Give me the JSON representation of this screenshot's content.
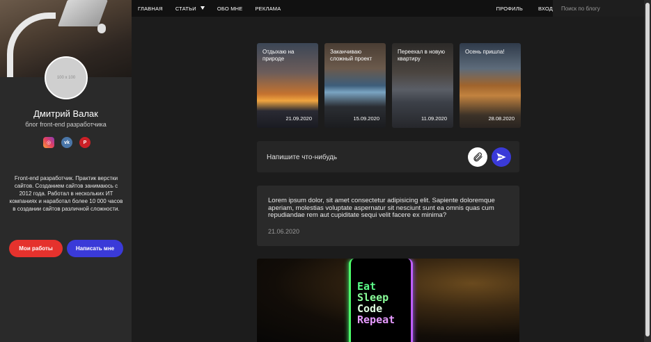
{
  "profile": {
    "avatar_placeholder": "100 x 100",
    "name": "Дмитрий Валак",
    "subtitle": "блог front-end разработчика",
    "socials": [
      {
        "name": "instagram-icon",
        "glyph": "◎"
      },
      {
        "name": "vk-icon",
        "glyph": "vk"
      },
      {
        "name": "pinterest-icon",
        "glyph": "P"
      }
    ],
    "bio": "Front-end разработчик. Практик верстки сайтов. Созданием сайтов занимаюсь с 2012 года. Работал в нескольких ИТ компаниях и наработал более 10 000 часов в создании сайтов различной сложности.",
    "btn_works": "Мои работы",
    "btn_write": "Написать мне"
  },
  "nav": {
    "home": "ГЛАВНАЯ",
    "articles": "СТАТЬИ",
    "about": "ОБО МНЕ",
    "ads": "РЕКЛАМА",
    "profile": "ПРОФИЛЬ",
    "login": "ВХОД",
    "search_placeholder": "Поиск по блогу"
  },
  "cards": [
    {
      "title": "Отдыхаю на природе",
      "date": "21.09.2020"
    },
    {
      "title": "Заканчиваю сложный проект",
      "date": "15.09.2020"
    },
    {
      "title": "Переехал в новую квартиру",
      "date": "11.09.2020"
    },
    {
      "title": "Осень пришла!",
      "date": "28.08.2020"
    }
  ],
  "composer": {
    "placeholder": "Напишите что-нибудь"
  },
  "post": {
    "text": "Lorem ipsum dolor, sit amet consectetur adipisicing elit. Sapiente doloremque aperiam, molestias voluptate aspernatur sit nesciunt sunt ea omnis quas cum repudiandae rem aut cupiditate sequi velit facere ex minima?",
    "date": "21.06.2020"
  },
  "image_post": {
    "lines": [
      "Eat",
      "Sleep",
      "Code",
      "Repeat"
    ]
  },
  "colors": {
    "accent_red": "#e5322d",
    "accent_blue": "#3a3ad8",
    "background": "#1c1c1c",
    "sidebar": "#2a2a2a"
  }
}
